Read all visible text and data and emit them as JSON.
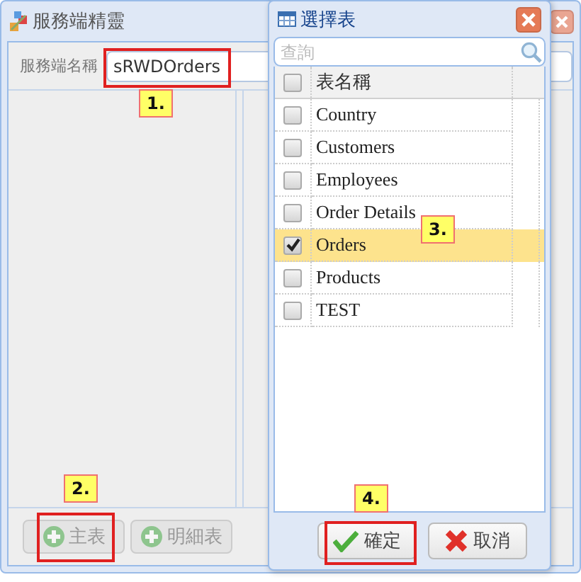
{
  "wizard": {
    "title": "服務端精靈",
    "name_label": "服務端名稱",
    "name_value": "sRWDOrders",
    "buttons": [
      {
        "label": "主表",
        "disabled": true
      },
      {
        "label": "明細表",
        "disabled": true
      }
    ]
  },
  "dialog": {
    "title": "選擇表",
    "search": {
      "placeholder": "查詢"
    },
    "column": "表名稱",
    "header_checked": false,
    "rows": [
      {
        "name": "Country",
        "checked": false,
        "selected": false
      },
      {
        "name": "Customers",
        "checked": false,
        "selected": false
      },
      {
        "name": "Employees",
        "checked": false,
        "selected": false
      },
      {
        "name": "Order Details",
        "checked": false,
        "selected": false
      },
      {
        "name": "Orders",
        "checked": true,
        "selected": true
      },
      {
        "name": "Products",
        "checked": false,
        "selected": false
      },
      {
        "name": "TEST",
        "checked": false,
        "selected": false
      }
    ],
    "buttons": [
      {
        "label": "確定",
        "kind": "ok"
      },
      {
        "label": "取消",
        "kind": "cancel"
      }
    ]
  },
  "callouts": [
    {
      "label": "1.",
      "highlight": true
    },
    {
      "label": "2.",
      "highlight": true
    },
    {
      "label": "3.",
      "highlight": false
    },
    {
      "label": "4.",
      "highlight": true
    }
  ]
}
